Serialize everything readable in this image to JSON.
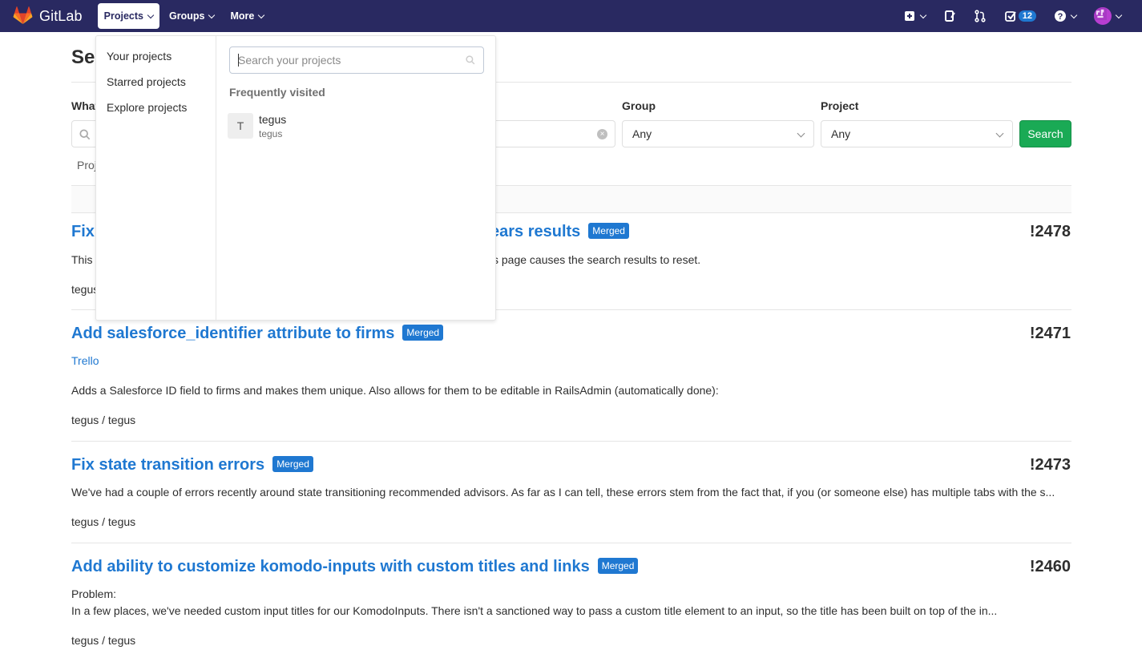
{
  "nav": {
    "brand": "GitLab",
    "items": [
      {
        "label": "Projects"
      },
      {
        "label": "Groups"
      },
      {
        "label": "More"
      }
    ],
    "todos_count": "12"
  },
  "page": {
    "title_partial": "Se",
    "scope_label_partial": "What",
    "group_label": "Group",
    "project_label": "Project",
    "group_value": "Any",
    "project_value": "Any",
    "search_button": "Search",
    "tab_partial": "Proj"
  },
  "dropdown": {
    "menu": [
      "Your projects",
      "Starred projects",
      "Explore projects"
    ],
    "search_placeholder": "Search your projects",
    "frequent_heading": "Frequently visited",
    "frequent": [
      {
        "avatar": "T",
        "name": "tegus",
        "namespace": "tegus"
      }
    ]
  },
  "results": [
    {
      "title_left": "Fix",
      "title_right": "ears results",
      "badge": "Merged",
      "iid": "!2478",
      "desc_left": "This",
      "desc_right": "s page causes the search results to reset.",
      "path_partial": "tegus"
    },
    {
      "title": "Add salesforce_identifier attribute to firms",
      "badge": "Merged",
      "iid": "!2471",
      "link": "Trello",
      "desc": "Adds a Salesforce ID field to firms and makes them unique. Also allows for them to be editable in RailsAdmin (automatically done):",
      "path": "tegus / tegus"
    },
    {
      "title": "Fix state transition errors",
      "badge": "Merged",
      "iid": "!2473",
      "desc": "We've had a couple of errors recently around state transitioning recommended advisors. As far as I can tell, these errors stem from the fact that, if you (or someone else) has multiple tabs with the s...",
      "path": "tegus / tegus"
    },
    {
      "title": "Add ability to customize komodo-inputs with custom titles and links",
      "badge": "Merged",
      "iid": "!2460",
      "desc_line1": "Problem:",
      "desc_line2": "In a few places, we've needed custom input titles for our KomodoInputs. There isn't a sanctioned way to pass a custom title element to an input, so the title has been built on top of the in...",
      "path": "tegus / tegus"
    }
  ],
  "colors": {
    "navbar": "#292961",
    "link": "#1f78d1",
    "success": "#1aaa55"
  }
}
